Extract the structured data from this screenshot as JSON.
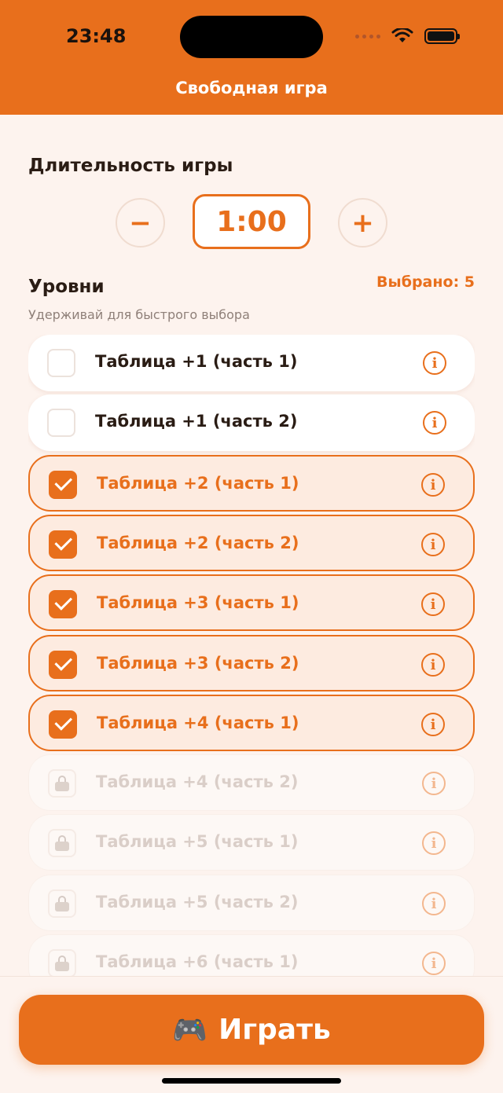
{
  "status_bar": {
    "time": "23:48"
  },
  "header": {
    "title": "Свободная игра"
  },
  "duration": {
    "title": "Длительность игры",
    "minus_label": "−",
    "value": "1:00",
    "plus_label": "+"
  },
  "levels": {
    "title": "Уровни",
    "selected_label": "Выбрано: 5",
    "hint": "Удерживай для быстрого выбора",
    "items": [
      {
        "label": "Таблица +1 (часть 1)",
        "state": "unselected"
      },
      {
        "label": "Таблица +1 (часть 2)",
        "state": "unselected"
      },
      {
        "label": "Таблица +2 (часть 1)",
        "state": "selected"
      },
      {
        "label": "Таблица +2 (часть 2)",
        "state": "selected"
      },
      {
        "label": "Таблица +3 (часть 1)",
        "state": "selected"
      },
      {
        "label": "Таблица +3 (часть 2)",
        "state": "selected"
      },
      {
        "label": "Таблица +4 (часть 1)",
        "state": "selected"
      },
      {
        "label": "Таблица +4 (часть 2)",
        "state": "locked"
      },
      {
        "label": "Таблица +5 (часть 1)",
        "state": "locked"
      },
      {
        "label": "Таблица +5 (часть 2)",
        "state": "locked"
      },
      {
        "label": "Таблица +6 (часть 1)",
        "state": "locked"
      }
    ],
    "info_glyph": "i"
  },
  "play_button": {
    "icon": "🎮",
    "label": "Играть"
  },
  "colors": {
    "accent": "#e86f1c",
    "background": "#fdf3ee"
  }
}
